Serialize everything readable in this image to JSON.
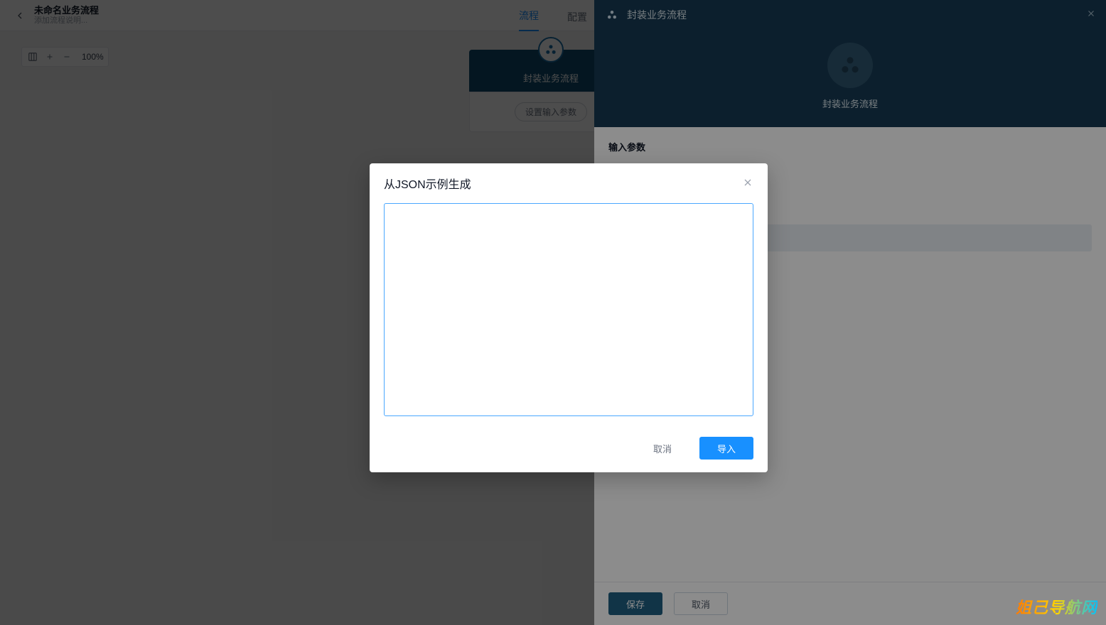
{
  "header": {
    "title": "未命名业务流程",
    "subtitle": "添加流程说明...",
    "tabs": {
      "flow": "流程",
      "config": "配置"
    }
  },
  "zoom": {
    "label": "100%"
  },
  "canvasNode": {
    "title": "封装业务流程",
    "action": "设置输入参数"
  },
  "sidePanel": {
    "title": "封装业务流程",
    "heroLabel": "封装业务流程",
    "sectionTitle": "输入参数",
    "saveLabel": "保存",
    "cancelLabel": "取消"
  },
  "modal": {
    "title": "从JSON示例生成",
    "textareaValue": "",
    "cancelLabel": "取消",
    "importLabel": "导入"
  },
  "watermark": "姐己导航网",
  "icons": {
    "back": "back-arrow",
    "fit": "fit-screen",
    "plus": "plus",
    "minus": "minus",
    "cluster": "cluster-circles",
    "close": "close-x"
  }
}
